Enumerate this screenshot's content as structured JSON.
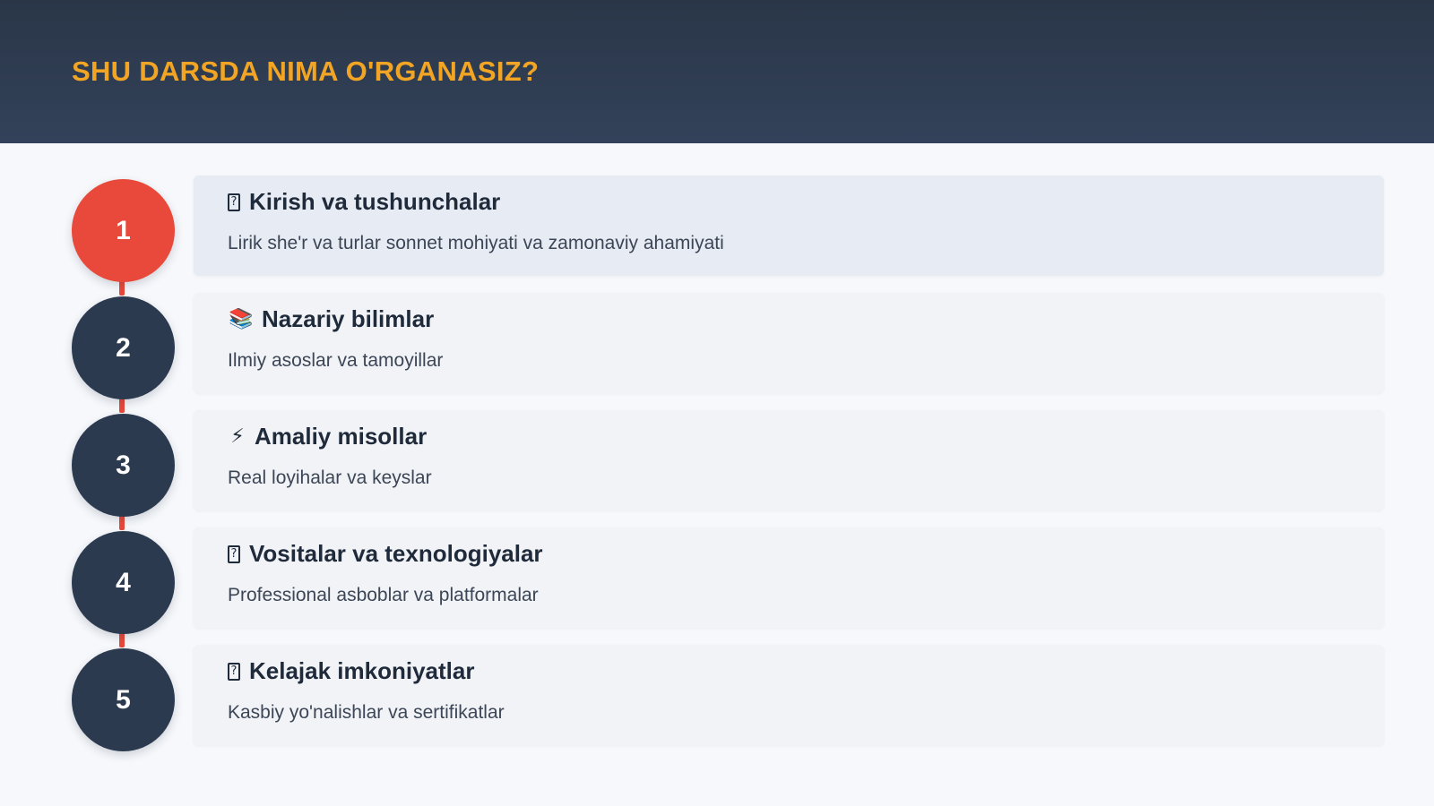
{
  "header": {
    "title": "SHU DARSDA NIMA O'RGANASIZ?"
  },
  "colors": {
    "accent": "#f2a524",
    "active": "#e8493a",
    "dark": "#2c3a50"
  },
  "steps": [
    {
      "number": "1",
      "icon": "?",
      "icon_name": "missing-glyph-icon",
      "title": "Kirish va tushunchalar",
      "description": "Lirik she'r va turlar sonnet mohiyati va zamonaviy ahamiyati",
      "active": true
    },
    {
      "number": "2",
      "icon": "📚",
      "icon_name": "books-icon",
      "title": "Nazariy bilimlar",
      "description": "Ilmiy asoslar va tamoyillar",
      "active": false
    },
    {
      "number": "3",
      "icon": "⚡",
      "icon_name": "lightning-icon",
      "title": "Amaliy misollar",
      "description": "Real loyihalar va keyslar",
      "active": false
    },
    {
      "number": "4",
      "icon": "?",
      "icon_name": "missing-glyph-icon",
      "title": "Vositalar va texnologiyalar",
      "description": "Professional asboblar va platformalar",
      "active": false
    },
    {
      "number": "5",
      "icon": "?",
      "icon_name": "missing-glyph-icon",
      "title": "Kelajak imkoniyatlar",
      "description": "Kasbiy yo'nalishlar va sertifikatlar",
      "active": false
    }
  ]
}
